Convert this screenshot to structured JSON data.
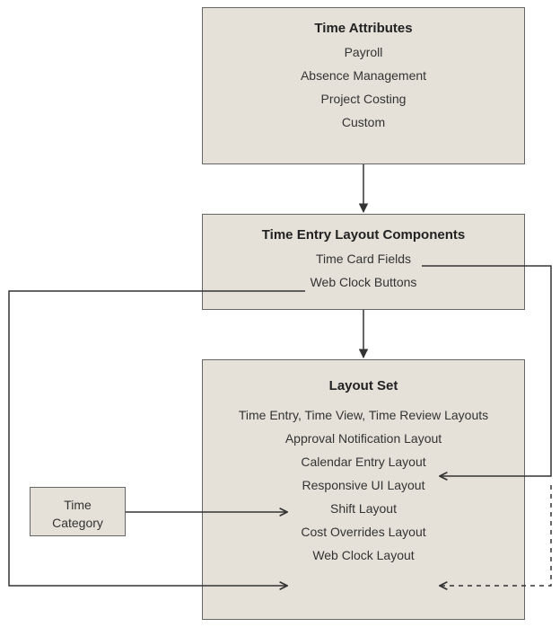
{
  "boxes": {
    "timeAttributes": {
      "title": "Time Attributes",
      "items": [
        "Payroll",
        "Absence Management",
        "Project Costing",
        "Custom"
      ]
    },
    "timeEntryLayoutComponents": {
      "title": "Time Entry Layout Components",
      "items": [
        "Time Card Fields",
        "Web Clock Buttons"
      ]
    },
    "layoutSet": {
      "title": "Layout Set",
      "items": [
        "Time Entry, Time View, Time Review Layouts",
        "Approval Notification Layout",
        "Calendar Entry Layout",
        "Responsive UI Layout",
        "Shift Layout",
        "Cost Overrides Layout",
        "Web Clock Layout"
      ]
    },
    "timeCategory": {
      "label": "Time\nCategory"
    }
  }
}
